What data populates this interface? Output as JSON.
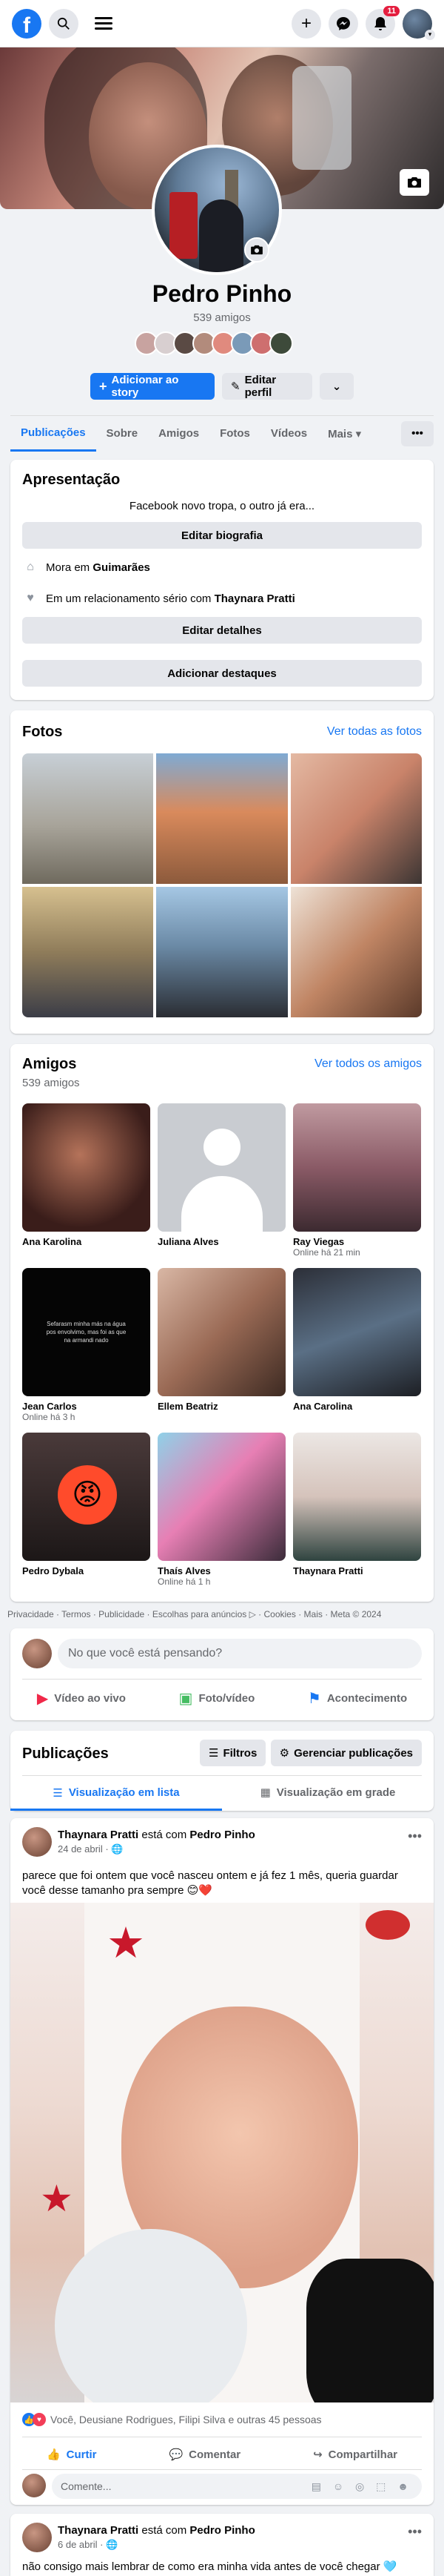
{
  "topbar": {
    "logo": "f",
    "notifications_badge": "11",
    "icons": [
      "search-icon",
      "menu-icon",
      "plus-icon",
      "messenger-icon",
      "bell-icon"
    ]
  },
  "profile": {
    "name": "Pedro Pinho",
    "friends_count": "539 amigos",
    "add_story": "Adicionar ao story",
    "edit_profile": "Editar perfil",
    "more": "⌄"
  },
  "tabs": [
    {
      "label": "Publicações"
    },
    {
      "label": "Sobre"
    },
    {
      "label": "Amigos"
    },
    {
      "label": "Fotos"
    },
    {
      "label": "Vídeos"
    },
    {
      "label": "Mais ▾"
    }
  ],
  "intro": {
    "title": "Apresentação",
    "bio": "Facebook novo tropa, o outro já era...",
    "edit_bio": "Editar biografia",
    "lives_prefix": "Mora em",
    "lives_city": "Guimarães",
    "relationship_prefix": "Em um relacionamento sério com",
    "relationship_person": "Thaynara Pratti",
    "edit_details": "Editar detalhes",
    "add_highlights": "Adicionar destaques"
  },
  "photos": {
    "title": "Fotos",
    "see_all": "Ver todas as fotos"
  },
  "friends": {
    "title": "Amigos",
    "count": "539 amigos",
    "see_all": "Ver todos os amigos",
    "items": [
      {
        "name": "Ana Karolina",
        "sub": ""
      },
      {
        "name": "Juliana Alves",
        "sub": ""
      },
      {
        "name": "Ray Viegas",
        "sub": "Online há 21 min"
      },
      {
        "name": "Jean Carlos",
        "sub": "Online há 3 h"
      },
      {
        "name": "Ellem Beatriz",
        "sub": ""
      },
      {
        "name": "Ana Carolina",
        "sub": ""
      },
      {
        "name": "Pedro Dybala",
        "sub": ""
      },
      {
        "name": "Thaís Alves",
        "sub": "Online há 1 h"
      },
      {
        "name": "Thaynara Pratti",
        "sub": ""
      }
    ],
    "jean_image_text": "Sefarasm minha más na água pos envolvimo, mas foi as que na armandi nado"
  },
  "footer": "Privacidade · Termos · Publicidade · Escolhas para anúncios ▷ · Cookies · Mais · Meta © 2024",
  "composer": {
    "placeholder": "No que você está pensando?",
    "live": "Vídeo ao vivo",
    "photo": "Foto/vídeo",
    "event": "Acontecimento"
  },
  "posts_header": {
    "title": "Publicações",
    "filters": "Filtros",
    "manage": "Gerenciar publicações",
    "list_view": "Visualização em lista",
    "grid_view": "Visualização em grade"
  },
  "post1": {
    "author": "Thaynara Pratti",
    "with_text": "está com",
    "with_name": "Pedro Pinho",
    "date": "24 de abril ·",
    "text": "parece que foi ontem que você nasceu ontem e já fez 1 mês, queria guardar você desse tamanho pra sempre 😊❤️",
    "reactions": "Você, Deusiane Rodrigues, Filipi Silva e outras 45 pessoas",
    "like": "Curtir",
    "comment": "Comentar",
    "share": "Compartilhar",
    "comment_placeholder": "Comente..."
  },
  "post2": {
    "author": "Thaynara Pratti",
    "with_text": "está com",
    "with_name": "Pedro Pinho",
    "date": "6 de abril ·",
    "text": "não consigo mais lembrar de como era minha vida antes de você chegar 🩵"
  }
}
